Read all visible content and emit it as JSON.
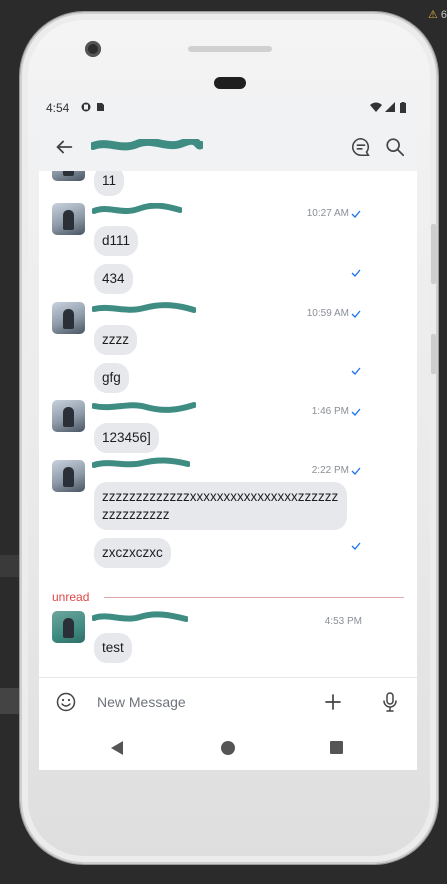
{
  "ide": {
    "warning_text": "6"
  },
  "status_bar": {
    "time": "4:54"
  },
  "app_bar": {
    "title_redacted": true
  },
  "messages": {
    "top_partial": {
      "text": "11"
    },
    "groups": [
      {
        "time": "10:27 AM",
        "messages": [
          "d111",
          "434"
        ]
      },
      {
        "time": "10:59 AM",
        "messages": [
          "zzzz",
          "gfg"
        ]
      },
      {
        "time": "1:46 PM",
        "messages": [
          "123456]"
        ]
      },
      {
        "time": "2:22 PM",
        "messages": [
          "zzzzzzzzzzzzzxxxxxxxxxxxxxxxxzzzzzzzzzzzzzzzz",
          "zxczxczxc"
        ]
      }
    ],
    "unread_label": "unread",
    "unread_group": {
      "time": "4:53 PM",
      "messages": [
        "test"
      ]
    }
  },
  "composer": {
    "placeholder": "New Message"
  },
  "colors": {
    "accent": "#1a73e8",
    "unread": "#e04646",
    "bubble": "#e6e8ec",
    "redaction": "#3f8c83",
    "header_bg": "#f1f2f4"
  },
  "icons": {
    "back": "arrow-left-icon",
    "chat": "chat-bubble-icon",
    "search": "search-icon",
    "emoji": "smiley-icon",
    "attach": "plus-icon",
    "mic": "mic-icon",
    "read_receipt": "check-icon"
  }
}
